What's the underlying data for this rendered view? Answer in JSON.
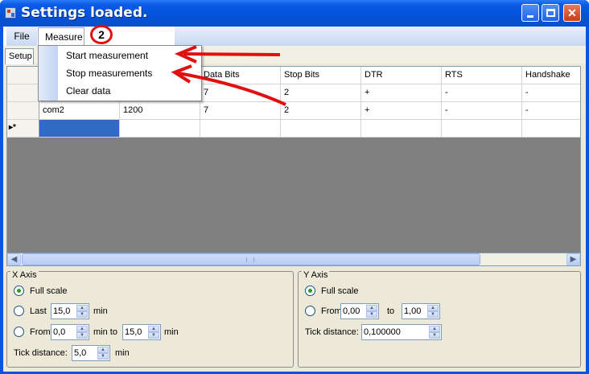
{
  "window": {
    "title": "Settings loaded."
  },
  "menubar": {
    "file_label": "File",
    "measure_label": "Measure"
  },
  "annotation": {
    "badge": "2"
  },
  "measure_menu": {
    "items": [
      {
        "label": "Start measurement"
      },
      {
        "label": "Stop measurements"
      },
      {
        "label": "Clear data"
      }
    ]
  },
  "tabs": {
    "setup_label": "Setup"
  },
  "grid": {
    "columns": [
      "",
      "",
      "Data Bits",
      "Stop Bits",
      "DTR",
      "RTS",
      "Handshake"
    ],
    "rows": [
      [
        "",
        "",
        "7",
        "2",
        "+",
        "-",
        "-"
      ],
      [
        "com2",
        "1200",
        "7",
        "2",
        "+",
        "-",
        "-"
      ]
    ],
    "new_row_marker": "▸*"
  },
  "x_axis": {
    "title": "X Axis",
    "full_scale_label": "Full scale",
    "last_label": "Last",
    "last_value": "15,0",
    "last_unit": "min",
    "from_label": "From",
    "from_value": "0,0",
    "to_label": "min to",
    "to_value": "15,0",
    "to_unit": "min",
    "tick_label": "Tick distance:",
    "tick_value": "5,0",
    "tick_unit": "min",
    "selected": "Full scale"
  },
  "y_axis": {
    "title": "Y Axis",
    "full_scale_label": "Full scale",
    "from_label": "From",
    "from_value": "0,00",
    "to_label": "to",
    "to_value": "1,00",
    "tick_label": "Tick distance:",
    "tick_value": "0,100000",
    "selected": "Full scale"
  },
  "colors": {
    "titlebar": "#0452d8",
    "selection": "#316ac5",
    "annotation": "#e01010"
  }
}
